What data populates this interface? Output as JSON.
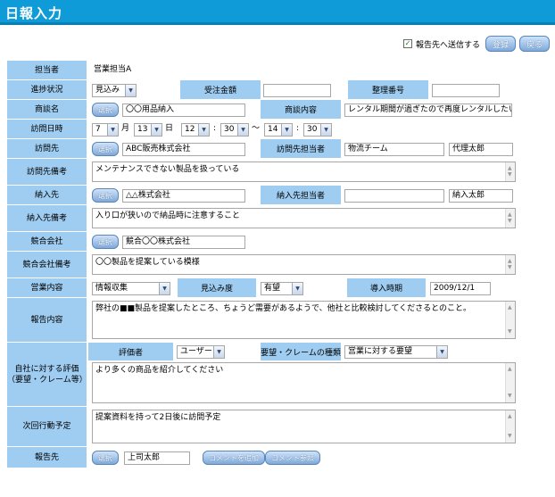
{
  "title": "日報入力",
  "top": {
    "send_label": "報告先へ送信する",
    "send_checked": true,
    "register_label": "登録",
    "back_label": "戻る"
  },
  "labels": {
    "tantou": "担当者",
    "shinchoku": "進捗状況",
    "juchu": "受注金額",
    "seiri": "整理番号",
    "shodanmei": "商談名",
    "shodannaiyou": "商談内容",
    "houmon_date": "訪問日時",
    "houmonsaki": "訪問先",
    "houmon_tantou": "訪問先担当者",
    "houmon_bikou": "訪問先備考",
    "nounyu": "納入先",
    "nounyu_tantou": "納入先担当者",
    "nounyu_bikou": "納入先備考",
    "kyougou": "競合会社",
    "kyougou_bikou": "競合会社備考",
    "eigyou_naiyou": "営業内容",
    "mikomido": "見込み度",
    "dounyu": "導入時期",
    "houkoku_naiyou": "報告内容",
    "hyouka_1": "自社に対する評価",
    "hyouka_2": "（要望・クレーム等）",
    "hyoukasha": "評価者",
    "youbou_shurui": "要望・クレームの種類",
    "jikai": "次回行動予定",
    "houkokusaki": "報告先"
  },
  "buttons": {
    "select": "選択",
    "add_comment": "コメントを追加",
    "view_comment": "コメント参照"
  },
  "date": {
    "month_unit": "月",
    "day_unit": "日",
    "colon": ":",
    "tilde": "～"
  },
  "values": {
    "tantou": "営業担当A",
    "shinchoku": "見込み",
    "juchu": "",
    "seiri": "",
    "shodanmei": "〇〇用品納入",
    "shodannaiyou": "レンタル期間が過ぎたので再度レンタルしたい",
    "month": "7",
    "day": "13",
    "start_hour": "12",
    "start_min": "30",
    "end_hour": "14",
    "end_min": "30",
    "houmonsaki": "ABC販売株式会社",
    "houmon_busho": "物流チーム",
    "houmon_tantou_name": "代理太郎",
    "houmon_bikou": "メンテナンスできない製品を扱っている",
    "nounyu": "△△株式会社",
    "nounyu_busho": "",
    "nounyu_tantou_name": "納入太郎",
    "nounyu_bikou": "入り口が狭いので納品時に注意すること",
    "kyougou": "競合〇〇株式会社",
    "kyougou_bikou": "〇〇製品を提案している模様",
    "eigyou_naiyou": "情報収集",
    "mikomido": "有望",
    "dounyu": "2009/12/1",
    "houkoku_naiyou": "弊社の■■製品を提案したところ、ちょうど需要があるようで、他社と比較検討してくださるとのこと。",
    "hyoukasha": "ユーザー",
    "youbou_shurui": "営業に対する要望",
    "hyouka_text": "より多くの商品を紹介してください",
    "jikai": "提案資料を持って2日後に訪問予定",
    "houkokusaki": "上司太郎"
  },
  "icons": {
    "check": "check-icon",
    "dropdown": "chevron-down-icon"
  },
  "colors": {
    "title_bar": "#0f9bd7",
    "label_bg": "#9fcdf2",
    "button": "#7fa9d9"
  }
}
